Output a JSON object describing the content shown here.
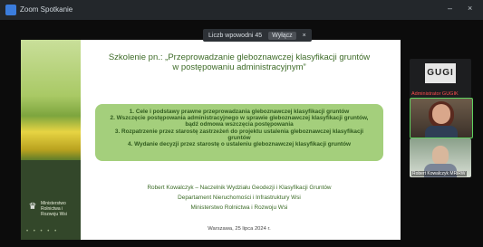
{
  "window": {
    "title": "Zoom Spotkanie",
    "controls": {
      "minimize": "–",
      "close": "×"
    }
  },
  "share_bar": {
    "text": "Liczb wpowodni 45",
    "stop_label": "Wyłącz",
    "close_label": "×"
  },
  "slide": {
    "title_line1": "Szkolenie pn.: „Przeprowadzanie gleboznawczej klasyfikacji gruntów",
    "title_line2": "w postępowaniu administracyjnym”",
    "agenda": [
      "1.  Cele i podstawy prawne przeprowadzania gleboznawczej klasyfikacji gruntów",
      "2.  Wszczęcie postępowania administracyjnego w sprawie gleboznawczej klasyfikacji gruntów, bądź odmowa wszczęcia postępowania",
      "3.  Rozpatrzenie przez starostę zastrzeżeń do projektu ustalenia gleboznawczej klasyfikacji gruntów",
      "4.  Wydanie decyzji przez starostę o ustaleniu gleboznawczej klasyfikacji gruntów"
    ],
    "author": "Robert Kowalczyk – Naczelnik Wydziału Geodezji i Klasyfikacji Gruntów",
    "department": "Departament Nieruchomości i Infrastruktury Wsi",
    "ministry": "Ministerstwo Rolnictwa i Rozwoju Wsi",
    "date": "Warszawa, 25 lipca 2024 r.",
    "sidebar_ministry": "Ministerstwo Rolnictwa i Rozwoju Wsi"
  },
  "participants": [
    {
      "logo": "GUGI",
      "name": "Administrator GUGIK"
    },
    {
      "name": ""
    },
    {
      "name": "Robert Kowalczyk MRiRW"
    }
  ]
}
